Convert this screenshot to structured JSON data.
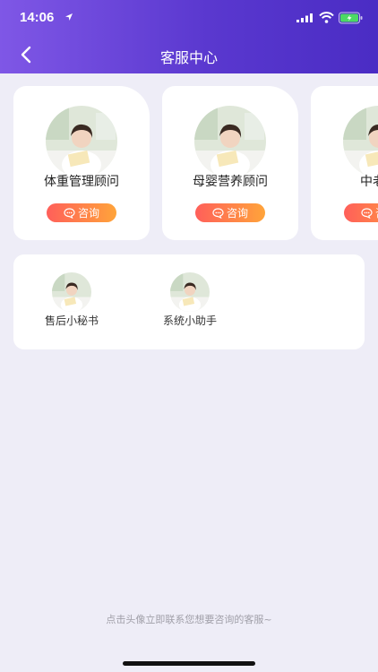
{
  "status_bar": {
    "time": "14:06"
  },
  "header": {
    "title": "客服中心"
  },
  "advisors": [
    {
      "name": "体重管理顾问",
      "button_label": "咨询"
    },
    {
      "name": "母婴营养顾问",
      "button_label": "咨询"
    },
    {
      "name": "中老年",
      "button_label": "咨询"
    }
  ],
  "assistants": [
    {
      "label": "售后小秘书"
    },
    {
      "label": "系统小助手"
    }
  ],
  "footer": {
    "hint": "点击头像立即联系您想要咨询的客服~"
  }
}
